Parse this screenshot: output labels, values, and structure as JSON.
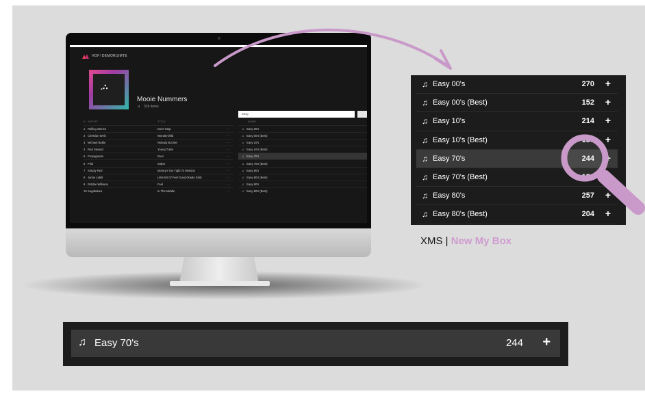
{
  "app": {
    "brand": "HOF! DEMORUIMTE"
  },
  "playlist": {
    "title": "Mooie Nummers",
    "count": "339 items",
    "search_value": "Easy"
  },
  "headers": {
    "num": "#",
    "artist": "ARTIST",
    "title": "TITLE",
    "name": "NAME"
  },
  "tracks": [
    {
      "n": "1",
      "artist": "Rolling Stones",
      "title": "Don't Stop",
      "more": "···"
    },
    {
      "n": "2",
      "artist": "Christian Welz",
      "title": "Wonderchild",
      "more": "···"
    },
    {
      "n": "3",
      "artist": "Michael Buble",
      "title": "Nobody But Me",
      "more": "···"
    },
    {
      "n": "4",
      "artist": "Rod Stewart",
      "title": "Young Turks",
      "more": "···"
    },
    {
      "n": "5",
      "artist": "Propaganda",
      "title": "Duel",
      "more": "···"
    },
    {
      "n": "6",
      "artist": "Pink",
      "title": "Sober",
      "more": "···"
    },
    {
      "n": "7",
      "artist": "Simply Red",
      "title": "Money's Too Tight To Mention",
      "more": "···"
    },
    {
      "n": "8",
      "artist": "Jamie Lidell",
      "title": "Little Bit Of Feel Good (Radio Edit)",
      "more": "···"
    },
    {
      "n": "9",
      "artist": "Robbie Williams",
      "title": "Feel",
      "more": "···"
    },
    {
      "n": "10",
      "artist": "Sugababes",
      "title": "In The Middle",
      "more": "···"
    }
  ],
  "mini_playlists": [
    {
      "name": "Easy 00's"
    },
    {
      "name": "Easy 00's (Best)"
    },
    {
      "name": "Easy 10's"
    },
    {
      "name": "Easy 10's (Best)"
    },
    {
      "name": "Easy 70's"
    },
    {
      "name": "Easy 70's (Best)"
    },
    {
      "name": "Easy 80's"
    },
    {
      "name": "Easy 80's (Best)"
    },
    {
      "name": "Easy 90's"
    },
    {
      "name": "Easy 90's (Best)"
    }
  ],
  "zoom_playlists": [
    {
      "name": "Easy 00's",
      "count": "270",
      "plus": "+"
    },
    {
      "name": "Easy 00's (Best)",
      "count": "152",
      "plus": "+"
    },
    {
      "name": "Easy 10's",
      "count": "214",
      "plus": "+"
    },
    {
      "name": "Easy 10's (Best)",
      "count": "130",
      "plus": "+"
    },
    {
      "name": "Easy 70's",
      "count": "244",
      "plus": "+"
    },
    {
      "name": "Easy 70's (Best)",
      "count": "152",
      "plus": "+"
    },
    {
      "name": "Easy 80's",
      "count": "257",
      "plus": "+"
    },
    {
      "name": "Easy 80's (Best)",
      "count": "204",
      "plus": "+"
    }
  ],
  "caption": {
    "prefix": "XMS | ",
    "brand": "New My Box"
  },
  "highlight": {
    "name": "Easy 70's",
    "count": "244",
    "plus": "+"
  },
  "icons": {
    "note": "♫",
    "magnifier": "magnifier-icon",
    "arrow": "curved-arrow"
  },
  "colors": {
    "accent": "#cf9bd0",
    "panel": "#1c1c1c",
    "highlight_row": "#3a3a3a",
    "background": "#dcdcdc"
  }
}
